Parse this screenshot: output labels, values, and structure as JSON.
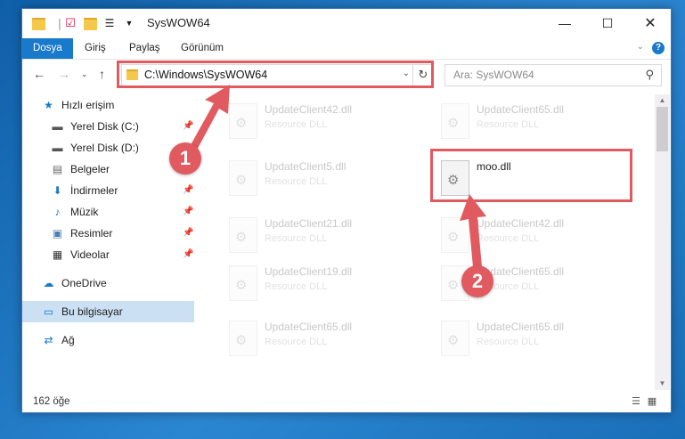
{
  "window": {
    "title": "SysWOW64"
  },
  "ribbon": {
    "tabs": [
      "Dosya",
      "Giriş",
      "Paylaş",
      "Görünüm"
    ],
    "help": "?"
  },
  "nav": {
    "address": "C:\\Windows\\SysWOW64",
    "search_placeholder": "Ara: SysWOW64"
  },
  "sidebar": {
    "items": [
      {
        "label": "Hızlı erişim",
        "icon": "star-icon",
        "pinned": false
      },
      {
        "label": "Yerel Disk (C:)",
        "icon": "drive-icon",
        "pinned": true
      },
      {
        "label": "Yerel Disk (D:)",
        "icon": "drive-icon",
        "pinned": false
      },
      {
        "label": "Belgeler",
        "icon": "document-icon",
        "pinned": true
      },
      {
        "label": "İndirmeler",
        "icon": "download-icon",
        "pinned": true
      },
      {
        "label": "Müzik",
        "icon": "music-icon",
        "pinned": true
      },
      {
        "label": "Resimler",
        "icon": "pictures-icon",
        "pinned": true
      },
      {
        "label": "Videolar",
        "icon": "video-icon",
        "pinned": true
      },
      {
        "label": "OneDrive",
        "icon": "cloud-icon",
        "pinned": false
      },
      {
        "label": "Bu bilgisayar",
        "icon": "computer-icon",
        "pinned": false
      },
      {
        "label": "Ağ",
        "icon": "network-icon",
        "pinned": false
      }
    ],
    "selected": "Bu bilgisayar"
  },
  "files": [
    {
      "name": "UpdateClient42.dll",
      "type": "Resource DLL",
      "faded": true
    },
    {
      "name": "UpdateClient65.dll",
      "type": "Resource DLL",
      "faded": true
    },
    {
      "name": "UpdateClient5.dll",
      "type": "Resource DLL",
      "faded": true
    },
    {
      "name": "moo.dll",
      "type": "",
      "faded": false
    },
    {
      "name": "UpdateClient21.dll",
      "type": "Resource DLL",
      "faded": true
    },
    {
      "name": "UpdateClient42.dll",
      "type": "Resource DLL",
      "faded": true
    },
    {
      "name": "UpdateClient19.dll",
      "type": "Resource DLL",
      "faded": true
    },
    {
      "name": "UpdateClient65.dll",
      "type": "Resource DLL",
      "faded": true
    },
    {
      "name": "UpdateClient65.dll",
      "type": "Resource DLL",
      "faded": true
    },
    {
      "name": "UpdateClient65.dll",
      "type": "Resource DLL",
      "faded": true
    }
  ],
  "status": {
    "count": "162 öğe"
  },
  "annotations": {
    "step1": "1",
    "step2": "2",
    "color": "#e05a60"
  }
}
